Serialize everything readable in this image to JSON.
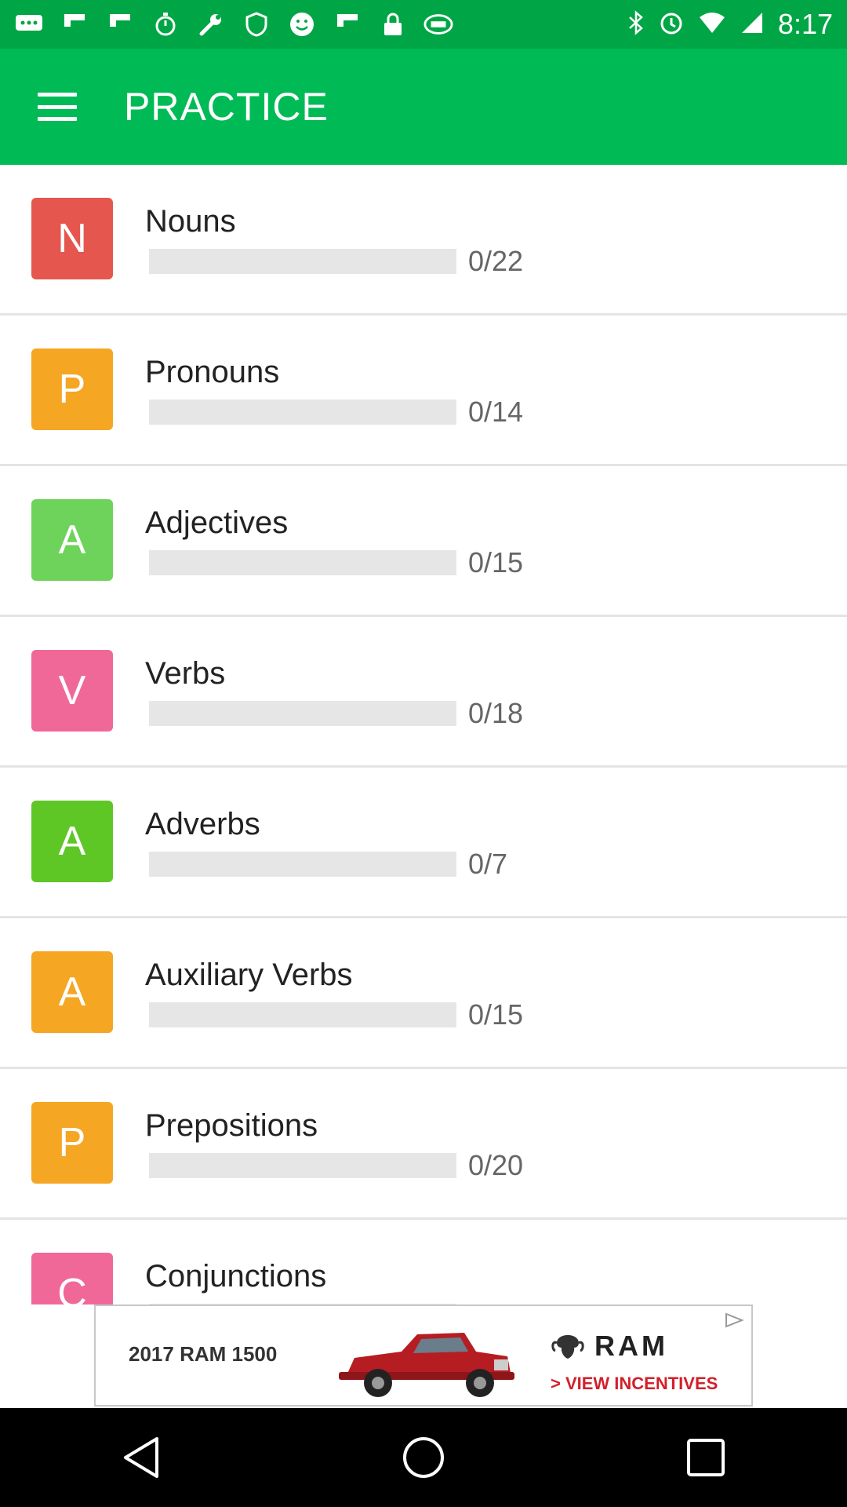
{
  "status_bar": {
    "time": "8:17",
    "icons": [
      "chat-icon",
      "flipboard-icon",
      "flipboard-icon",
      "stopwatch-icon",
      "wrench-icon",
      "shield-icon",
      "smiley-icon",
      "flipboard-icon",
      "lock-icon",
      "fox-sports-icon",
      "bluetooth-icon",
      "alarm-icon",
      "wifi-icon",
      "signal-icon"
    ]
  },
  "app_bar": {
    "title": "PRACTICE",
    "menu_icon": "menu-icon",
    "color": "#00bb55"
  },
  "topics": [
    {
      "letter": "N",
      "name": "Nouns",
      "count": "0/22",
      "progress": 0,
      "color": "#e5574e"
    },
    {
      "letter": "P",
      "name": "Pronouns",
      "count": "0/14",
      "progress": 0,
      "color": "#f5a623"
    },
    {
      "letter": "A",
      "name": "Adjectives",
      "count": "0/15",
      "progress": 0,
      "color": "#6ed35a"
    },
    {
      "letter": "V",
      "name": "Verbs",
      "count": "0/18",
      "progress": 0,
      "color": "#f06898"
    },
    {
      "letter": "A",
      "name": "Adverbs",
      "count": "0/7",
      "progress": 0,
      "color": "#5ec726"
    },
    {
      "letter": "A",
      "name": "Auxiliary Verbs",
      "count": "0/15",
      "progress": 0,
      "color": "#f5a623"
    },
    {
      "letter": "P",
      "name": "Prepositions",
      "count": "0/20",
      "progress": 0,
      "color": "#f5a623"
    },
    {
      "letter": "C",
      "name": "Conjunctions",
      "count": "",
      "progress": 0,
      "color": "#f06898"
    }
  ],
  "ad": {
    "headline": "2017 RAM 1500",
    "brand": "RAM",
    "cta": "> VIEW INCENTIVES"
  },
  "nav_bar": {
    "icons": [
      "back-icon",
      "home-icon",
      "recents-icon"
    ]
  }
}
